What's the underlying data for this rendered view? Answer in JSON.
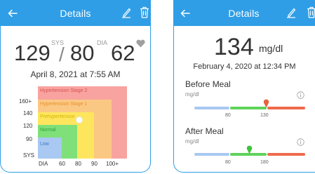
{
  "left_screen": {
    "header": {
      "title": "Details",
      "back_icon": "arrow-left-icon",
      "edit_icon": "pencil-icon",
      "delete_icon": "trash-icon",
      "color": "#2f9ee6"
    },
    "reading": {
      "systolic": "129",
      "separator": "/",
      "diastolic": "80",
      "pulse": "62",
      "sys_label": "SYS",
      "dia_label": "DIA",
      "pulse_icon": "heart-icon"
    },
    "date": "April 8, 2021 at 7:55 AM",
    "chart": {
      "y_ticks": [
        "160+",
        "140",
        "120",
        "90"
      ],
      "y_axis_label": "SYS",
      "x_axis_label": "DIA",
      "x_ticks": [
        "60",
        "80",
        "90",
        "100+"
      ],
      "zones": [
        {
          "name": "Hypertension Stage 2",
          "color": "#f8a3a0",
          "text_color": "#d9534f"
        },
        {
          "name": "Hypertension Stage 1",
          "color": "#fbc884",
          "text_color": "#e8912c"
        },
        {
          "name": "Prehypertension",
          "color": "#fde65e",
          "text_color": "#d4b300"
        },
        {
          "name": "Normal",
          "color": "#7fe07a",
          "text_color": "#2e9f3a"
        },
        {
          "name": "Low",
          "color": "#a9c8f2",
          "text_color": "#3f78c5"
        }
      ],
      "marker": {
        "systolic": 129,
        "diastolic": 80
      }
    }
  },
  "right_screen": {
    "header": {
      "title": "Details",
      "back_icon": "arrow-left-icon",
      "edit_icon": "pencil-icon",
      "delete_icon": "trash-icon"
    },
    "reading": {
      "value": "134",
      "unit": "mg/dl"
    },
    "date": "February 4, 2020 at 12:34 PM",
    "sections": [
      {
        "title": "Before Meal",
        "unit": "mg/dl",
        "info_icon": "info-icon",
        "tick_low": "80",
        "tick_high": "130",
        "marker_value": 134,
        "marker_color": "#e8623c"
      },
      {
        "title": "After Meal",
        "unit": "mg/dl",
        "info_icon": "info-icon",
        "tick_low": "80",
        "tick_high": "180",
        "marker_value": 134,
        "marker_color": "#3cc43c"
      }
    ],
    "bar_colors": {
      "low": "#a9c8f2",
      "normal": "#5ed35a",
      "high": "#ef6a4d"
    }
  }
}
